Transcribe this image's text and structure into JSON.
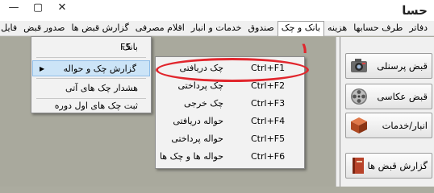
{
  "window": {
    "title": "حسا",
    "controls": [
      "—",
      "▢",
      "✕"
    ]
  },
  "menubar": {
    "items": [
      {
        "label": "فایل",
        "active": false
      },
      {
        "label": "صدور قبض",
        "active": false
      },
      {
        "label": "گزارش قبض ها",
        "active": false
      },
      {
        "label": "اقلام مصرفی",
        "active": false
      },
      {
        "label": "خدمات و انبار",
        "active": false
      },
      {
        "label": "صندوق",
        "active": false
      },
      {
        "label": "بانک و چک",
        "active": true
      },
      {
        "label": "هزینه",
        "active": false
      },
      {
        "label": "طرف حسابها",
        "active": false
      },
      {
        "label": "دفاتر",
        "active": false
      }
    ]
  },
  "sidebar": {
    "buttons": [
      {
        "label": "قبض پرسنلی",
        "icon": "camera-icon"
      },
      {
        "label": "قبض عکاسی",
        "icon": "film-reel-icon"
      },
      {
        "label": "انبار/خدمات",
        "icon": "box-icon"
      },
      {
        "label": "گزارش قبض ها",
        "icon": "book-icon"
      }
    ]
  },
  "dropdown": {
    "items": [
      {
        "label": "بانک",
        "shortcut": "F5"
      },
      {
        "label": "گزارش چک و حواله",
        "shortcut": "",
        "submenu": true
      },
      {
        "label": "هشدار چک های آتی",
        "shortcut": ""
      },
      {
        "label": "ثبت چک های اول دوره",
        "shortcut": ""
      }
    ]
  },
  "submenu": {
    "items": [
      {
        "label": "چک دریافتی",
        "shortcut": "Ctrl+F1"
      },
      {
        "label": "چک پرداختی",
        "shortcut": "Ctrl+F2"
      },
      {
        "label": "چک خرجی",
        "shortcut": "Ctrl+F3"
      },
      {
        "label": "حواله دریافتی",
        "shortcut": "Ctrl+F4"
      },
      {
        "label": "حواله پرداختی",
        "shortcut": "Ctrl+F5"
      },
      {
        "label": "حواله ها و چک ها",
        "shortcut": "Ctrl+F6"
      }
    ]
  },
  "annotation": {
    "number": "١",
    "color": "#e1262d"
  }
}
